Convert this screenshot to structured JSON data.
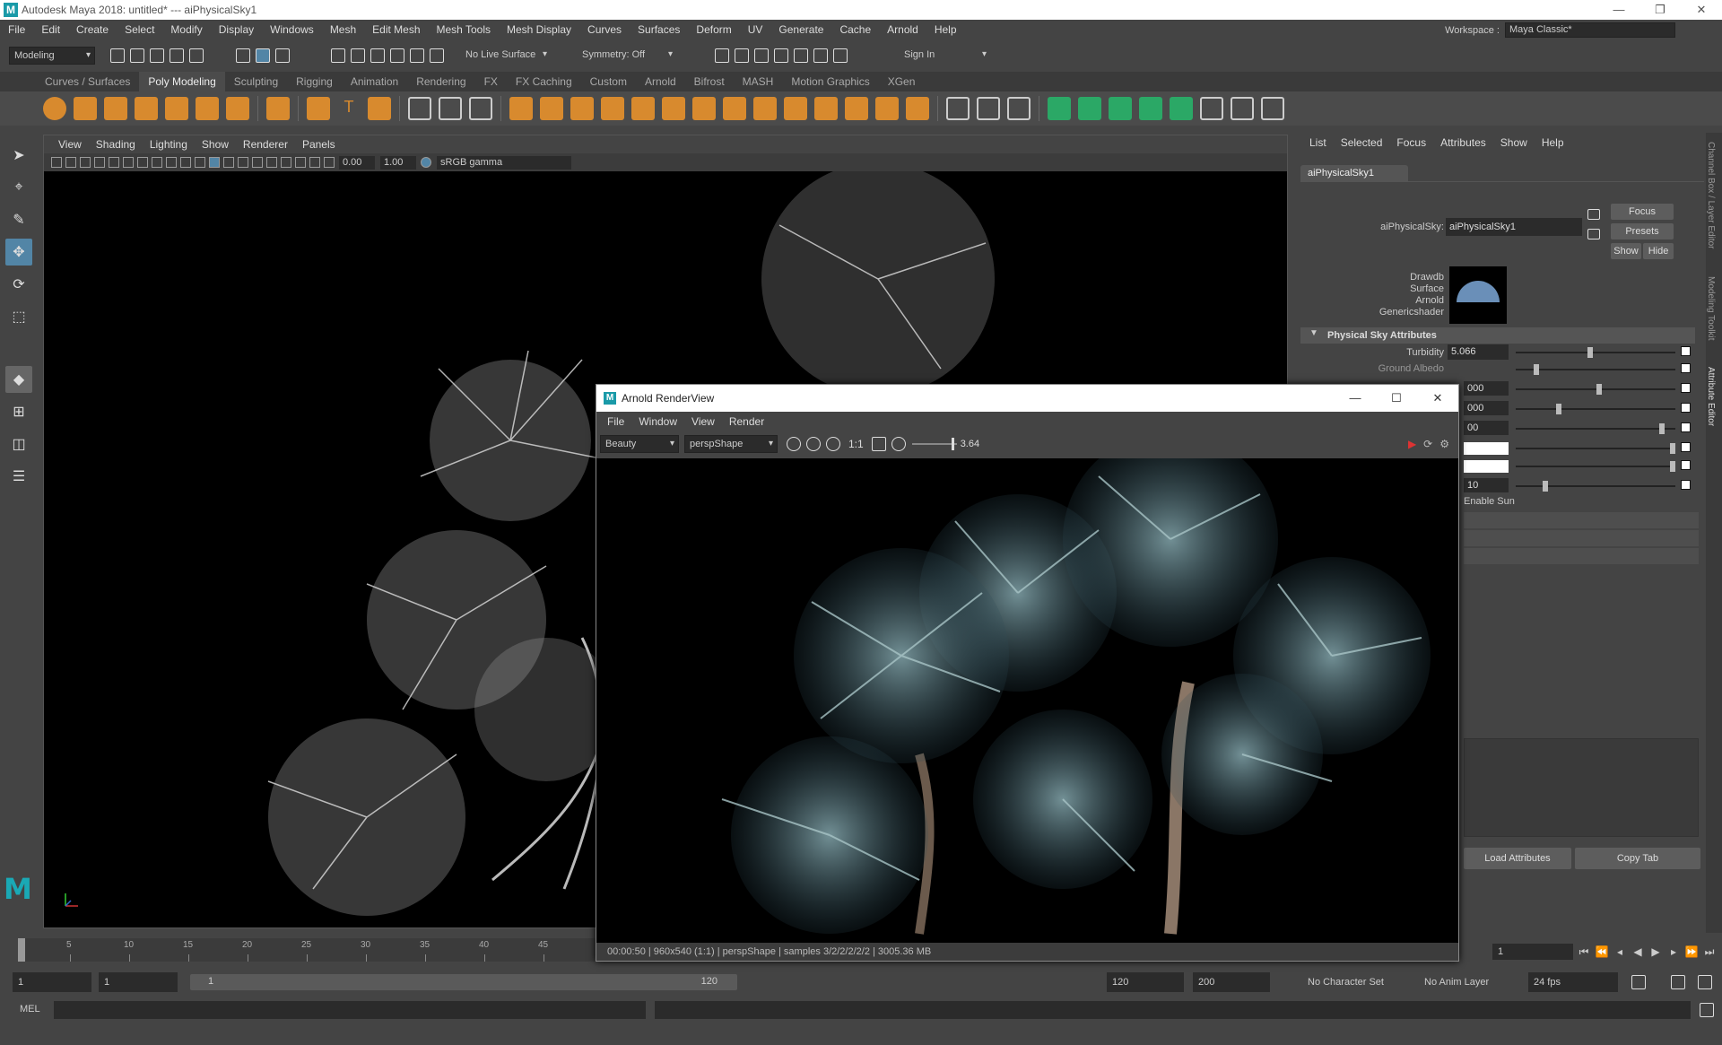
{
  "window": {
    "title": "Autodesk Maya 2018: untitled*   ---   aiPhysicalSky1"
  },
  "menubar": [
    "File",
    "Edit",
    "Create",
    "Select",
    "Modify",
    "Display",
    "Windows",
    "Mesh",
    "Edit Mesh",
    "Mesh Tools",
    "Mesh Display",
    "Curves",
    "Surfaces",
    "Deform",
    "UV",
    "Generate",
    "Cache",
    "Arnold",
    "Help"
  ],
  "workspace": {
    "label": "Workspace :",
    "value": "Maya Classic*"
  },
  "statusline": {
    "mode": "Modeling",
    "live_surface": "No Live Surface",
    "symmetry": "Symmetry: Off",
    "sign_in": "Sign In"
  },
  "shelf_tabs": [
    "Curves / Surfaces",
    "Poly Modeling",
    "Sculpting",
    "Rigging",
    "Animation",
    "Rendering",
    "FX",
    "FX Caching",
    "Custom",
    "Arnold",
    "Bifrost",
    "MASH",
    "Motion Graphics",
    "XGen"
  ],
  "shelf_active": "Poly Modeling",
  "viewport": {
    "menu": [
      "View",
      "Shading",
      "Lighting",
      "Show",
      "Renderer",
      "Panels"
    ],
    "exposure": "0.00",
    "gamma": "1.00",
    "color_space": "sRGB gamma"
  },
  "attr_editor": {
    "menu": [
      "List",
      "Selected",
      "Focus",
      "Attributes",
      "Show",
      "Help"
    ],
    "tab": "aiPhysicalSky1",
    "node_label": "aiPhysicalSky:",
    "node_value": "aiPhysicalSky1",
    "buttons": {
      "focus": "Focus",
      "presets": "Presets",
      "show": "Show",
      "hide": "Hide"
    },
    "shader_lines": [
      "Drawdb",
      "Surface",
      "Arnold",
      "Genericshader"
    ],
    "section": "Physical Sky Attributes",
    "turbidity_label": "Turbidity",
    "turbidity_value": "5.066",
    "ground_albedo_label": "Ground Albedo",
    "partial_values": [
      "000",
      "000",
      "00",
      "10"
    ],
    "enable_sun": "Enable Sun",
    "load_btn": "Load Attributes",
    "copy_btn": "Copy Tab",
    "side_tabs": [
      "Channel Box / Layer Editor",
      "Modeling Toolkit",
      "Attribute Editor"
    ]
  },
  "render_view": {
    "title": "Arnold RenderView",
    "menu": [
      "File",
      "Window",
      "View",
      "Render"
    ],
    "aov": "Beauty",
    "camera": "perspShape",
    "ratio": "1:1",
    "exposure": "3.64",
    "status": "00:00:50 | 960x540 (1:1) | perspShape  | samples 3/2/2/2/2/2 | 3005.36 MB"
  },
  "timeline": {
    "ticks": [
      "5",
      "10",
      "15",
      "20",
      "25",
      "30",
      "35",
      "40",
      "45"
    ],
    "current_frame": "1"
  },
  "range": {
    "start": "1",
    "playback_start": "1",
    "slider_start": "1",
    "slider_end": "120",
    "playback_end": "120",
    "end": "200",
    "character_set": "No Character Set",
    "anim_layer": "No Anim Layer",
    "fps": "24 fps"
  },
  "cmdline": {
    "label": "MEL"
  }
}
